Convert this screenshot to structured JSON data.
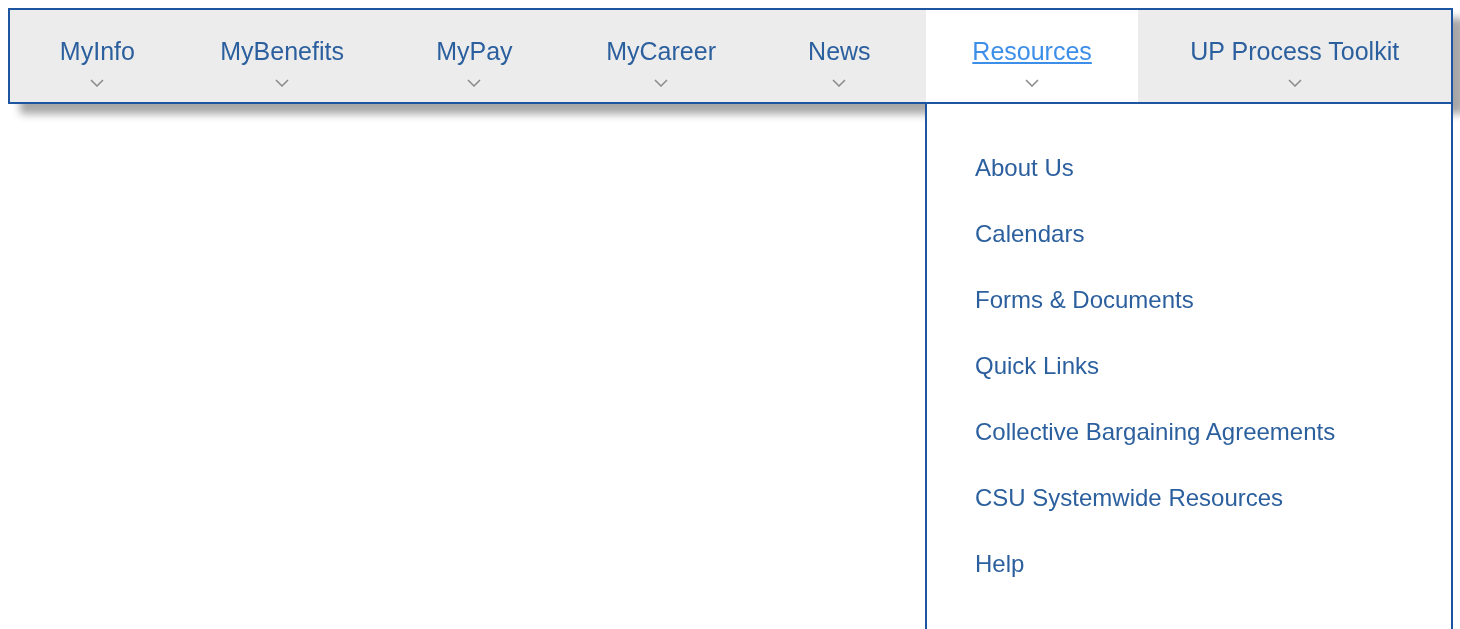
{
  "nav_items": [
    {
      "label": "MyInfo",
      "selected": false
    },
    {
      "label": "MyBenefits",
      "selected": false
    },
    {
      "label": "MyPay",
      "selected": false
    },
    {
      "label": "MyCareer",
      "selected": false
    },
    {
      "label": "News",
      "selected": false
    },
    {
      "label": "Resources",
      "selected": true
    },
    {
      "label": "UP Process Toolkit",
      "selected": false
    }
  ],
  "dropdown": {
    "items": [
      "About Us",
      "Calendars",
      "Forms & Documents",
      "Quick Links",
      "Collective Bargaining Agreements",
      "CSU Systemwide Resources",
      "Help"
    ]
  }
}
